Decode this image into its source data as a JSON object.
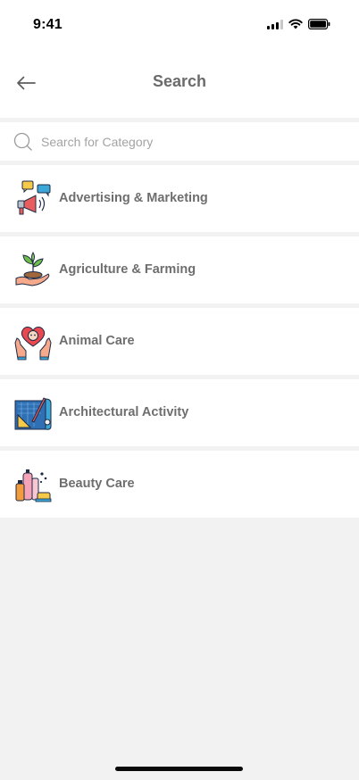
{
  "status_bar": {
    "time": "9:41"
  },
  "header": {
    "title": "Search"
  },
  "search": {
    "placeholder": "Search for Category",
    "value": ""
  },
  "categories": [
    {
      "label": "Advertising & Marketing",
      "icon": "megaphone-icon"
    },
    {
      "label": "Agriculture & Farming",
      "icon": "plant-hand-icon"
    },
    {
      "label": "Animal Care",
      "icon": "pet-heart-hands-icon"
    },
    {
      "label": "Architectural Activity",
      "icon": "blueprint-icon"
    },
    {
      "label": "Beauty Care",
      "icon": "cosmetics-icon"
    }
  ],
  "colors": {
    "background": "#f2f2f2",
    "card": "#ffffff",
    "title_text": "#6b6b6b",
    "label_text": "#6e6e6e",
    "placeholder": "#a3a3a3"
  }
}
